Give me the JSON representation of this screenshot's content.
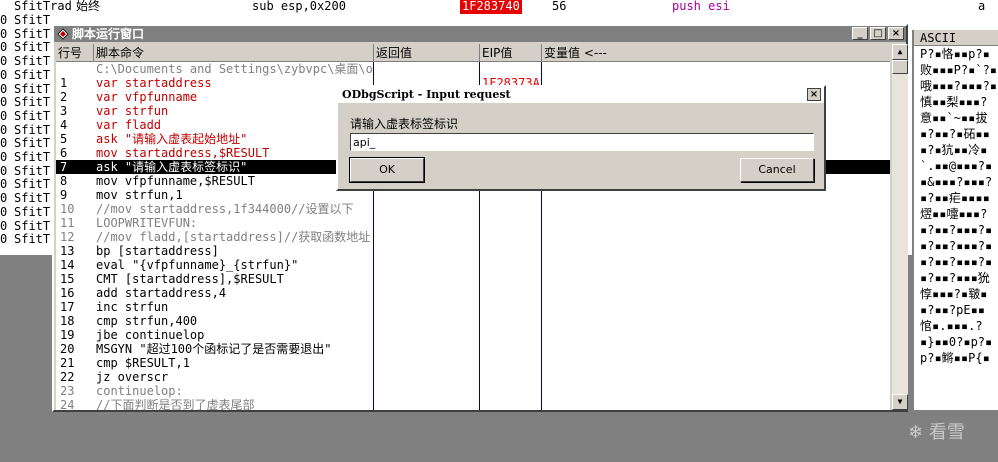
{
  "background": {
    "top_row": {
      "col1": "SfitTrad",
      "col2": "始终",
      "instr": "sub esp,0x200",
      "addr": "1F283740",
      "bytes": "56",
      "asm": "push esi",
      "tail": "a"
    },
    "left_rows": [
      "SfitT",
      "SfitT",
      "SfitT",
      "SfitT",
      "SfitT",
      "SfitT",
      "SfitT",
      "SfitT",
      "SfitT",
      "SfitT",
      "SfitT",
      "SfitT",
      "SfitT",
      "SfitT",
      "SfitT",
      "SfitT",
      "SfitT"
    ]
  },
  "ascii_panel": {
    "header": "ASCII",
    "rows": [
      "P?▪恪▪▪p?▪",
      "败▪▪▪P?▪`?▪",
      "哦▪▪▪?▪▪▪?▪",
      "慎▪▪梨▪▪▪?",
      "意▪▪`~▪▪拔",
      "▪?▪▪?▪砳▪▪",
      "▪?▪犺▪▪冷▪",
      "`.▪▪@▪▪▪?▪",
      "▪&▪▪▪?▪▪▪?",
      "▪?▪▪疟▪▪▪▪",
      "熤▪▪嚏▪▪▪?",
      "▪?▪▪?▪▪▪?▪",
      "▪?▪▪?▪▪▪?▪",
      "▪?▪▪?▪▪▪?▪",
      "▪?▪▪?▪▪▪狁",
      "惇▪▪▪?▪皲▪",
      "▪?▪▪?pE▪▪",
      "悺▪.▪▪▪.?",
      "▪}▪▪0?▪p?▪",
      "p?▪鳉▪▪P{▪"
    ]
  },
  "script_window": {
    "title": "脚本运行窗口",
    "columns": {
      "line": "行号",
      "command": "脚本命令",
      "return": "返回值",
      "eip": "EIP值",
      "variable": "变量值 <---"
    },
    "rows": [
      {
        "ln": "",
        "cmd": "C:\\Documents and Settings\\zybvpc\\桌面\\od",
        "eip": "",
        "style": "gray"
      },
      {
        "ln": "1",
        "cmd": " var  startaddress",
        "eip": "1F28373A",
        "style": "red"
      },
      {
        "ln": "2",
        "cmd": " var  vfpfunname",
        "eip": "",
        "style": "red"
      },
      {
        "ln": "3",
        "cmd": " var  strfun",
        "eip": "",
        "style": "red"
      },
      {
        "ln": "4",
        "cmd": " var  fladd",
        "eip": "",
        "style": "red"
      },
      {
        "ln": "5",
        "cmd": " ask  \"请输入虚表起始地址\"",
        "eip": "",
        "style": "red"
      },
      {
        "ln": "6",
        "cmd": " mov  startaddress,$RESULT",
        "eip": "",
        "style": "red"
      },
      {
        "ln": "7",
        "cmd": " ask  \"请输入虚表标签标识\"",
        "eip": "",
        "style": "sel"
      },
      {
        "ln": "8",
        "cmd": " mov  vfpfunname,$RESULT",
        "eip": "",
        "style": ""
      },
      {
        "ln": "9",
        "cmd": " mov  strfun,1",
        "eip": "",
        "style": ""
      },
      {
        "ln": "10",
        "cmd": " //mov  startaddress,1f344000//设置以下",
        "eip": "",
        "style": "gray"
      },
      {
        "ln": "11",
        "cmd": "LOOPWRITEVFUN:",
        "eip": "",
        "style": "gray"
      },
      {
        "ln": "12",
        "cmd": " //mov fladd,[startaddress]//获取函数地址",
        "eip": "",
        "style": "gray"
      },
      {
        "ln": "13",
        "cmd": " bp   [startaddress]",
        "eip": "",
        "style": ""
      },
      {
        "ln": "14",
        "cmd": " eval \"{vfpfunname}_{strfun}\"",
        "eip": "",
        "style": ""
      },
      {
        "ln": "15",
        "cmd": " CMT  [startaddress],$RESULT",
        "eip": "",
        "style": ""
      },
      {
        "ln": "16",
        "cmd": " add  startaddress,4",
        "eip": "",
        "style": ""
      },
      {
        "ln": "17",
        "cmd": " inc  strfun",
        "eip": "",
        "style": ""
      },
      {
        "ln": "18",
        "cmd": " cmp  strfun,400",
        "eip": "",
        "style": ""
      },
      {
        "ln": "19",
        "cmd": " jbe  continuelop",
        "eip": "",
        "style": ""
      },
      {
        "ln": "20",
        "cmd": " MSGYN  \"超过100个函标记了是否需要退出\"",
        "eip": "",
        "style": ""
      },
      {
        "ln": "21",
        "cmd": " cmp  $RESULT,1",
        "eip": "",
        "style": ""
      },
      {
        "ln": "22",
        "cmd": " jz   overscr",
        "eip": "",
        "style": ""
      },
      {
        "ln": "23",
        "cmd": "continuelop:",
        "eip": "",
        "style": "gray"
      },
      {
        "ln": "24",
        "cmd": " //下面判断是否到了虚表尾部",
        "eip": "",
        "style": "gray"
      }
    ],
    "buttons": {
      "minimize": "_",
      "maximize": "□",
      "close": "×"
    }
  },
  "dialog": {
    "title": "ODbgScript - Input request",
    "prompt": "请输入虚表标签标识",
    "input_value": "api_",
    "ok_label": "OK",
    "cancel_label": "Cancel",
    "close": "×"
  },
  "watermark": "看雪"
}
